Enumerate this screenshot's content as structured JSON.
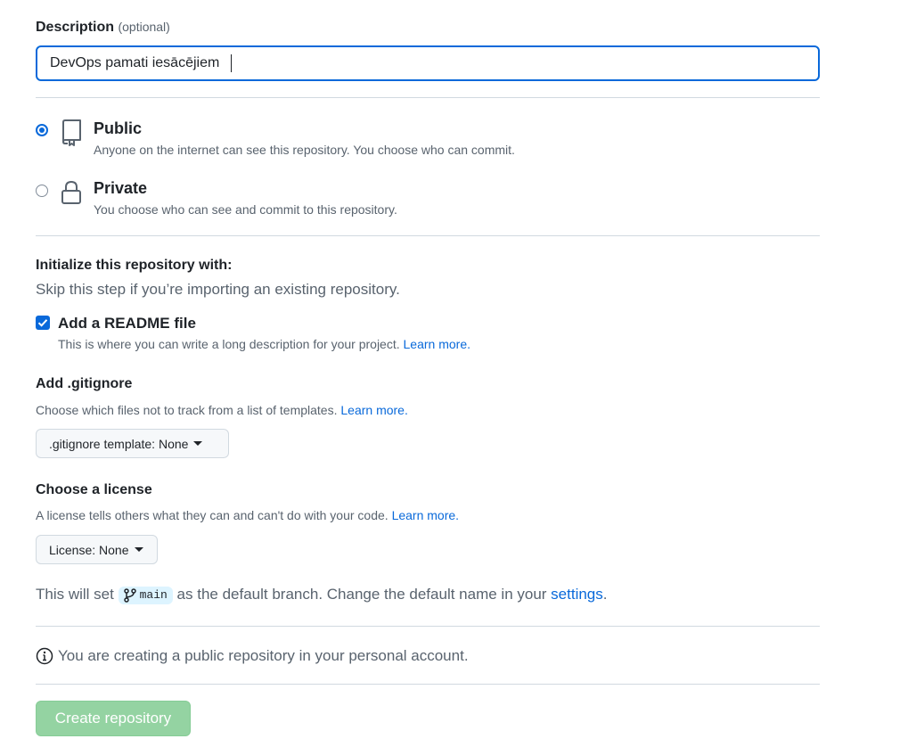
{
  "description": {
    "label": "Description",
    "optional": "(optional)",
    "value": "DevOps pamati iesācējiem"
  },
  "visibility": {
    "public": {
      "title": "Public",
      "desc": "Anyone on the internet can see this repository. You choose who can commit.",
      "checked": true,
      "icon": "repo-icon"
    },
    "private": {
      "title": "Private",
      "desc": "You choose who can see and commit to this repository.",
      "checked": false,
      "icon": "lock-icon"
    }
  },
  "init": {
    "heading": "Initialize this repository with:",
    "subtitle": "Skip this step if you’re importing an existing repository.",
    "readme": {
      "label": "Add a README file",
      "checked": true,
      "desc": "This is where you can write a long description for your project.",
      "link": "Learn more."
    }
  },
  "gitignore": {
    "heading": "Add .gitignore",
    "desc": "Choose which files not to track from a list of templates.",
    "link": "Learn more.",
    "button": ".gitignore template: None"
  },
  "license": {
    "heading": "Choose a license",
    "desc": "A license tells others what they can and can't do with your code.",
    "link": "Learn more.",
    "button": "License: None"
  },
  "branch": {
    "prefix": "This will set",
    "name": "main",
    "suffix": "as the default branch. Change the default name in your",
    "link": "settings",
    "end": "."
  },
  "info": {
    "text": "You are creating a public repository in your personal account.",
    "icon": "info-icon"
  },
  "create_button": "Create repository",
  "colors": {
    "accent": "#0969da",
    "create_button_bg": "#94d3a2",
    "muted_text": "#59636e"
  }
}
